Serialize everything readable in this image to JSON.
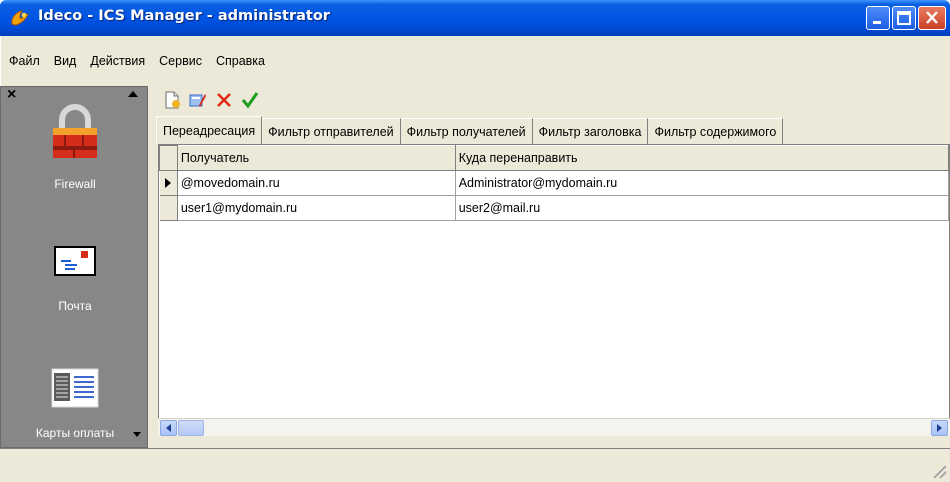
{
  "window": {
    "title": "Ideco - ICS Manager - administrator",
    "colors": {
      "titlebar": "#0055e5",
      "sidebar": "#878787",
      "chrome": "#ece9d8"
    }
  },
  "menu": [
    "Файл",
    "Вид",
    "Действия",
    "Сервис",
    "Справка"
  ],
  "sidebar": {
    "items": [
      {
        "label": "Firewall",
        "icon": "padlock-icon"
      },
      {
        "label": "Почта",
        "icon": "envelope-icon"
      },
      {
        "label": "Карты оплаты",
        "icon": "cards-icon"
      }
    ]
  },
  "toolbar": {
    "buttons": [
      {
        "icon": "new-document-icon"
      },
      {
        "icon": "edit-icon"
      },
      {
        "icon": "delete-icon"
      },
      {
        "icon": "apply-check-icon"
      }
    ]
  },
  "tabs": [
    {
      "label": "Переадресация",
      "active": true
    },
    {
      "label": "Фильтр отправителей",
      "active": false
    },
    {
      "label": "Фильтр получателей",
      "active": false
    },
    {
      "label": "Фильтр заголовка",
      "active": false
    },
    {
      "label": "Фильтр содержимого",
      "active": false
    }
  ],
  "grid": {
    "columns": [
      "Получатель",
      "Куда перенаправить"
    ],
    "rows": [
      {
        "cells": [
          "@movedomain.ru",
          "Administrator@mydomain.ru"
        ],
        "current": true
      },
      {
        "cells": [
          "user1@mydomain.ru",
          "user2@mail.ru"
        ],
        "current": false
      }
    ]
  }
}
